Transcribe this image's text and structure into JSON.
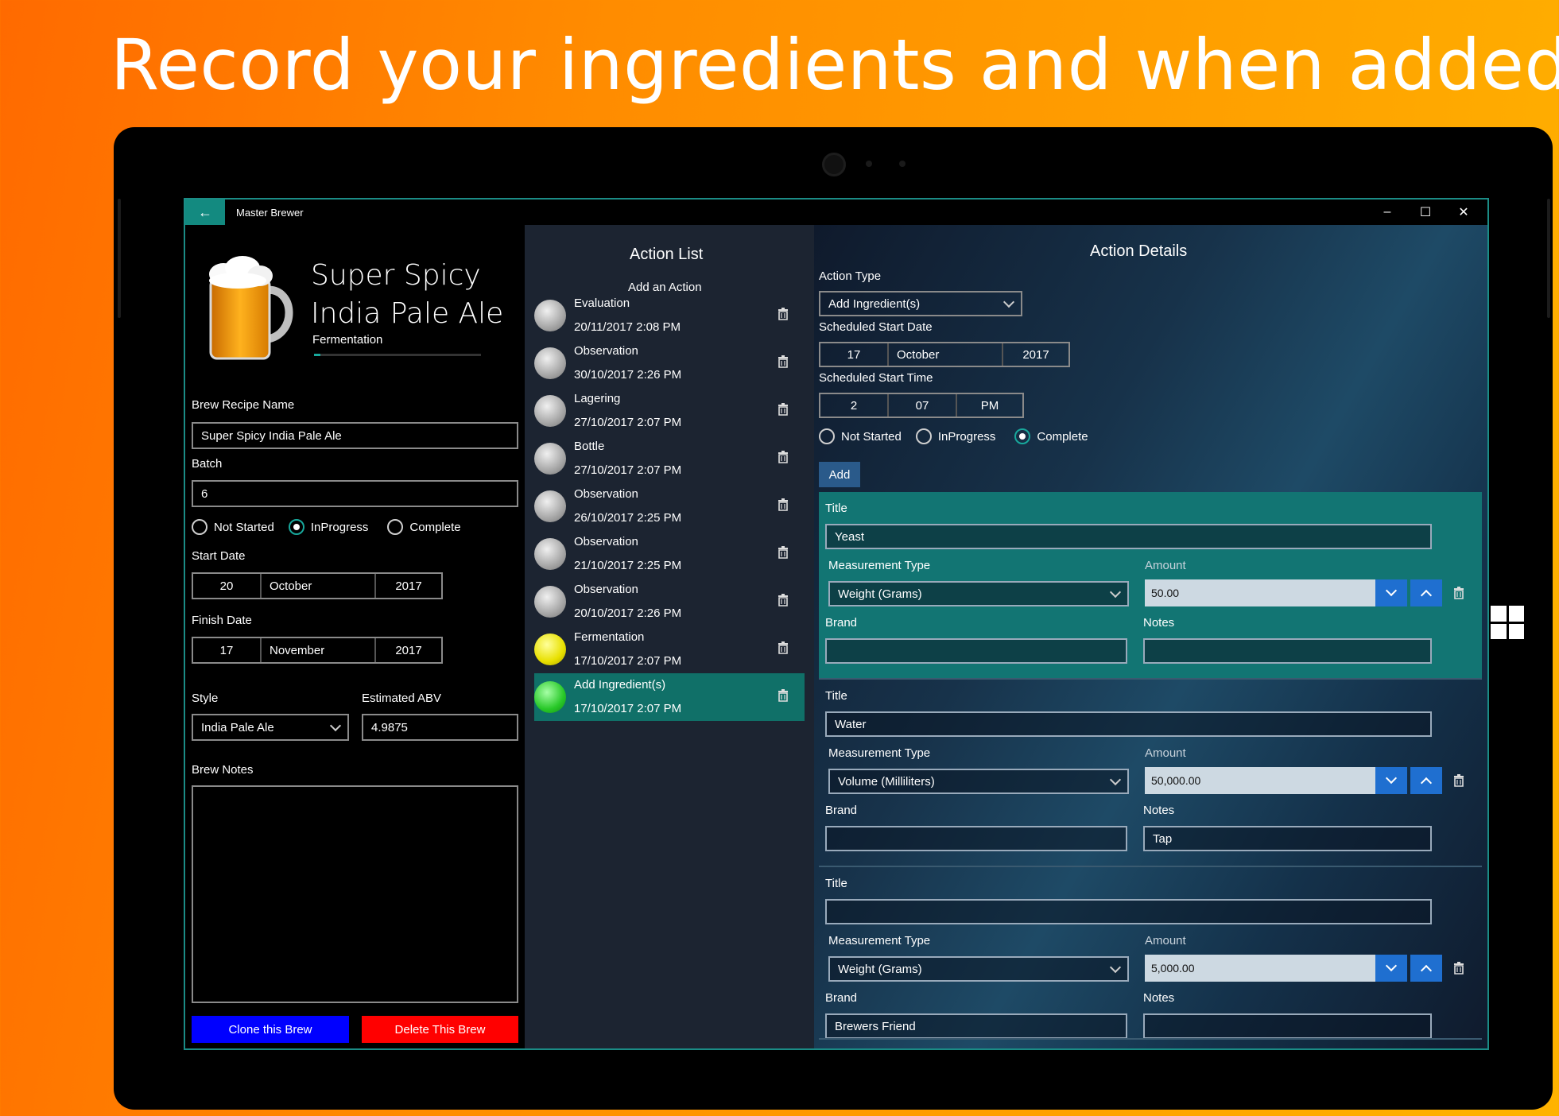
{
  "headline": "Record your ingredients and when added",
  "app": {
    "title": "Master Brewer",
    "back_glyph": "←",
    "minimize": "–",
    "maximize": "☐",
    "close": "✕"
  },
  "brew": {
    "title_line1": "Super Spicy",
    "title_line2": "India Pale Ale",
    "stage": "Fermentation",
    "stage_progress": 0.04,
    "recipe_name_label": "Brew Recipe Name",
    "recipe_name": "Super Spicy India Pale Ale",
    "batch_label": "Batch",
    "batch": "6",
    "status_options": [
      "Not Started",
      "InProgress",
      "Complete"
    ],
    "status_selected": "InProgress",
    "start_date_label": "Start Date",
    "start_date": {
      "day": "20",
      "month": "October",
      "year": "2017"
    },
    "finish_date_label": "Finish Date",
    "finish_date": {
      "day": "17",
      "month": "November",
      "year": "2017"
    },
    "style_label": "Style",
    "style": "India Pale Ale",
    "abv_label": "Estimated ABV",
    "abv": "4.9875",
    "notes_label": "Brew Notes",
    "notes": "",
    "clone_label": "Clone this Brew",
    "delete_label": "Delete This Brew"
  },
  "action_list": {
    "title": "Action List",
    "add_label": "Add an Action",
    "items": [
      {
        "name": "Evaluation",
        "date": "20/11/2017 2:08 PM",
        "color": "gray"
      },
      {
        "name": "Observation",
        "date": "30/10/2017 2:26 PM",
        "color": "gray"
      },
      {
        "name": "Lagering",
        "date": "27/10/2017 2:07 PM",
        "color": "gray"
      },
      {
        "name": "Bottle",
        "date": "27/10/2017 2:07 PM",
        "color": "gray"
      },
      {
        "name": "Observation",
        "date": "26/10/2017 2:25 PM",
        "color": "gray"
      },
      {
        "name": "Observation",
        "date": "21/10/2017 2:25 PM",
        "color": "gray"
      },
      {
        "name": "Observation",
        "date": "20/10/2017 2:26 PM",
        "color": "gray"
      },
      {
        "name": "Fermentation",
        "date": "17/10/2017 2:07 PM",
        "color": "yellow"
      },
      {
        "name": "Add Ingredient(s)",
        "date": "17/10/2017 2:07 PM",
        "color": "green",
        "selected": true
      }
    ]
  },
  "details": {
    "title": "Action Details",
    "action_type_label": "Action Type",
    "action_type": "Add Ingredient(s)",
    "start_date_label": "Scheduled Start Date",
    "start_date": {
      "day": "17",
      "month": "October",
      "year": "2017"
    },
    "start_time_label": "Scheduled Start Time",
    "start_time": {
      "hour": "2",
      "minute": "07",
      "period": "PM"
    },
    "status_options": [
      "Not Started",
      "InProgress",
      "Complete"
    ],
    "status_selected": "Complete",
    "add_label": "Add",
    "field_labels": {
      "title": "Title",
      "measurement": "Measurement Type",
      "amount": "Amount",
      "brand": "Brand",
      "notes": "Notes"
    },
    "ingredients": [
      {
        "title": "Yeast",
        "measurement": "Weight (Grams)",
        "amount": "50.00",
        "brand": "",
        "notes": ""
      },
      {
        "title": "Water",
        "measurement": "Volume (Milliliters)",
        "amount": "50,000.00",
        "brand": "",
        "notes": "Tap"
      },
      {
        "title": "",
        "measurement": "Weight (Grams)",
        "amount": "5,000.00",
        "brand": "Brewers Friend",
        "notes": ""
      }
    ]
  },
  "colors": {
    "accent": "#138a80",
    "selected": "#107068",
    "clone_button": "#0000ff",
    "delete_button": "#ff0000",
    "spinner": "#1f6fd0"
  }
}
